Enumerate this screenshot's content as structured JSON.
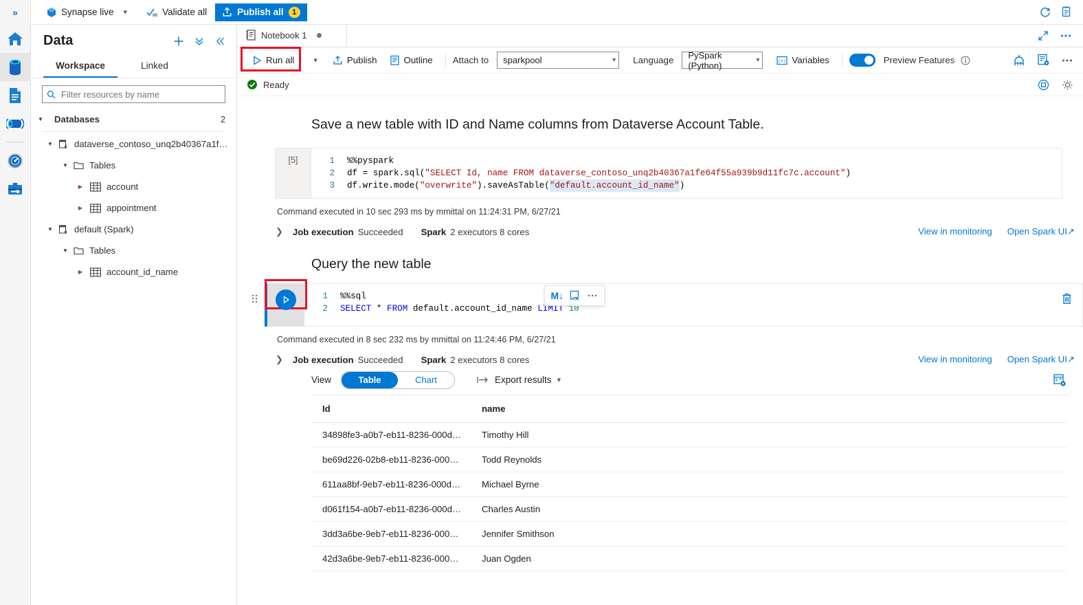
{
  "rail": {
    "expand_label": "»",
    "items": [
      {
        "name": "home",
        "label": "Home"
      },
      {
        "name": "data",
        "label": "Data",
        "active": true
      },
      {
        "name": "develop",
        "label": "Develop"
      },
      {
        "name": "integrate",
        "label": "Integrate"
      },
      {
        "name": "monitor",
        "label": "Monitor"
      },
      {
        "name": "manage",
        "label": "Manage"
      }
    ]
  },
  "topbar": {
    "synapse_live": "Synapse live",
    "validate_all": "Validate all",
    "publish_all": "Publish all",
    "publish_badge": "1",
    "accent": "#0078d4",
    "badge_color": "#ffd335"
  },
  "data_panel": {
    "title": "Data",
    "tabs": [
      {
        "label": "Workspace",
        "selected": true
      },
      {
        "label": "Linked",
        "selected": false
      }
    ],
    "filter_placeholder": "Filter resources by name",
    "filter_value": "",
    "tree": {
      "root_label": "Databases",
      "root_count": "2",
      "databases": [
        {
          "label": "dataverse_contoso_unq2b40367a1f…",
          "folder": "Tables",
          "tables": [
            "account",
            "appointment"
          ]
        },
        {
          "label": "default (Spark)",
          "folder": "Tables",
          "tables": [
            "account_id_name"
          ]
        }
      ]
    }
  },
  "notebook": {
    "tab_label": "Notebook 1",
    "toolbar": {
      "run_all": "Run all",
      "publish": "Publish",
      "outline": "Outline",
      "attach_to_label": "Attach to",
      "attach_to_value": "sparkpool",
      "language_label": "Language",
      "language_value": "PySpark (Python)",
      "variables": "Variables",
      "preview_features": "Preview Features"
    },
    "status": "Ready",
    "cells": [
      {
        "kind": "markdown",
        "text": "Save a new table with ID and Name columns from Dataverse Account Table."
      },
      {
        "kind": "code",
        "exec_count": "[5]",
        "lines": [
          "1",
          "2",
          "3"
        ],
        "code_line_1": "%%pyspark",
        "code_line_2_a": "df = spark.sql(",
        "code_line_2_str": "\"SELECT Id, name FROM dataverse_contoso_unq2b40367a1fe64f55a939b9d11fc7c.account\"",
        "code_line_2_b": ")",
        "code_line_3_a": "df.write.mode(",
        "code_line_3_str1": "\"overwrite\"",
        "code_line_3_mid": ").saveAsTable(",
        "code_line_3_str2": "\"default.account_id_name\"",
        "code_line_3_b": ")",
        "command_executed": "Command executed in 10 sec 293 ms by mmittal on 11:24:31 PM, 6/27/21",
        "job_execution_label": "Job execution",
        "job_execution_status": "Succeeded",
        "spark_label": "Spark",
        "spark_detail": "2 executors 8 cores",
        "link_monitoring": "View in monitoring",
        "link_spark_ui": "Open Spark UI"
      },
      {
        "kind": "markdown",
        "text": "Query the new table"
      },
      {
        "kind": "code",
        "cell_toolbar": {
          "markdown_icon": "M↓",
          "clear_output_icon": "clear-output",
          "more_icon": "···"
        },
        "lines": [
          "1",
          "2"
        ],
        "code_line_1": "%%sql",
        "code_line_2_k1": "SELECT",
        "code_line_2_star": " * ",
        "code_line_2_k2": "FROM",
        "code_line_2_tbl": " default.account_id_name ",
        "code_line_2_k3": "LIMIT",
        "code_line_2_num": " 10",
        "command_executed": "Command executed in 8 sec 232 ms by mmittal on 11:24:46 PM, 6/27/21",
        "job_execution_label": "Job execution",
        "job_execution_status": "Succeeded",
        "spark_label": "Spark",
        "spark_detail": "2 executors 8 cores",
        "link_monitoring": "View in monitoring",
        "link_spark_ui": "Open Spark UI"
      }
    ],
    "results": {
      "view_label": "View",
      "toggle": [
        {
          "label": "Table",
          "selected": true
        },
        {
          "label": "Chart",
          "selected": false
        }
      ],
      "export_label": "Export results",
      "columns": [
        "Id",
        "name"
      ],
      "rows": [
        [
          "34898fe3-a0b7-eb11-8236-000d…",
          "Timothy Hill"
        ],
        [
          "be69d226-02b8-eb11-8236-000…",
          "Todd Reynolds"
        ],
        [
          "611aa8bf-9eb7-eb11-8236-000d…",
          "Michael Byrne"
        ],
        [
          "d061f154-a0b7-eb11-8236-000d…",
          "Charles Austin"
        ],
        [
          "3dd3a6be-9eb7-eb11-8236-000…",
          "Jennifer Smithson"
        ],
        [
          "42d3a6be-9eb7-eb11-8236-000…",
          "Juan Ogden"
        ]
      ]
    }
  },
  "highlights": {
    "color": "#e81123",
    "targets": [
      "run-all-button",
      "cell-run-button"
    ]
  }
}
